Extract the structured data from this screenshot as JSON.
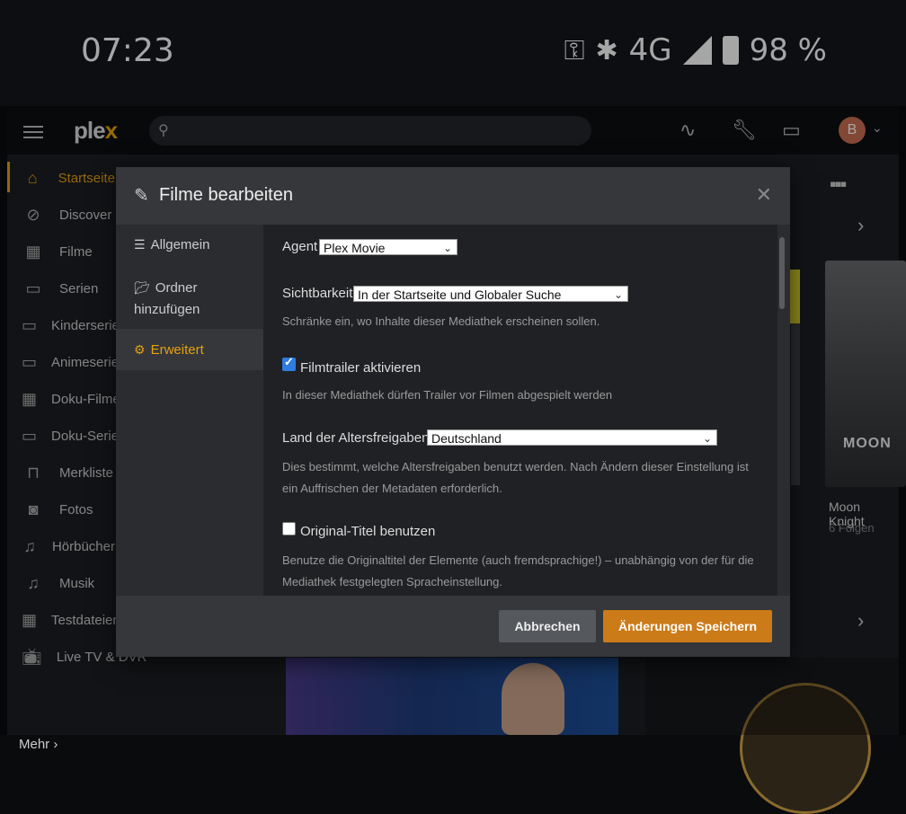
{
  "status_bar": {
    "time": "07:23",
    "network": "4G",
    "battery": "98 %"
  },
  "app": {
    "logo_main": "ple",
    "logo_x": "x",
    "sidebar": {
      "items": [
        {
          "label": "Startseite",
          "icon": "home-icon"
        },
        {
          "label": "Discover",
          "icon": "compass-icon"
        },
        {
          "label": "Filme",
          "icon": "film-icon"
        },
        {
          "label": "Serien",
          "icon": "tv-icon"
        },
        {
          "label": "Kinderserien",
          "icon": "tv-icon"
        },
        {
          "label": "Animeserien",
          "icon": "tv-icon"
        },
        {
          "label": "Doku-Filme",
          "icon": "film-icon"
        },
        {
          "label": "Doku-Serien",
          "icon": "tv-icon"
        },
        {
          "label": "Merkliste",
          "icon": "bookmark-icon"
        },
        {
          "label": "Fotos",
          "icon": "camera-icon"
        },
        {
          "label": "Hörbücher",
          "icon": "music-icon"
        },
        {
          "label": "Musik",
          "icon": "music-icon"
        },
        {
          "label": "Testdateien",
          "icon": "film-icon"
        },
        {
          "label": "Live TV & DVR",
          "icon": "live-tv-icon"
        }
      ],
      "more": "Mehr"
    },
    "background_card": {
      "title": "Moon Knight",
      "subtitle": "6 Folgen",
      "poster_text": "MOON"
    }
  },
  "modal": {
    "title": "Filme bearbeiten",
    "nav": [
      {
        "label": "Allgemein"
      },
      {
        "label": "Ordner hinzufügen"
      },
      {
        "label": "Erweitert"
      }
    ],
    "agent": {
      "label": "Agent",
      "value": "Plex Movie"
    },
    "visibility": {
      "label": "Sichtbarkeit",
      "value": "In der Startseite und Globaler Suche",
      "help": "Schränke ein, wo Inhalte dieser Mediathek erscheinen sollen."
    },
    "trailers": {
      "label": "Filmtrailer aktivieren",
      "checked": true,
      "help": "In dieser Mediathek dürfen Trailer vor Filmen abgespielt werden"
    },
    "rating_country": {
      "label": "Land der Altersfreigaben",
      "value": "Deutschland",
      "help": "Dies bestimmt, welche Altersfreigaben benutzt werden. Nach Ändern dieser Einstellung ist ein Auffrischen der Metadaten erforderlich."
    },
    "original_title": {
      "label": "Original-Titel benutzen",
      "checked": false,
      "help": "Benutze die Originaltitel der Elemente (auch fremdsprachige!) – unabhängig von der für die Mediathek festgelegten Spracheinstellung."
    },
    "cancel_label": "Abbrechen",
    "save_label": "Änderungen Speichern"
  },
  "colors": {
    "accent": "#e5a00d",
    "save_button": "#cc7b19",
    "checkbox": "#2f7de0"
  }
}
